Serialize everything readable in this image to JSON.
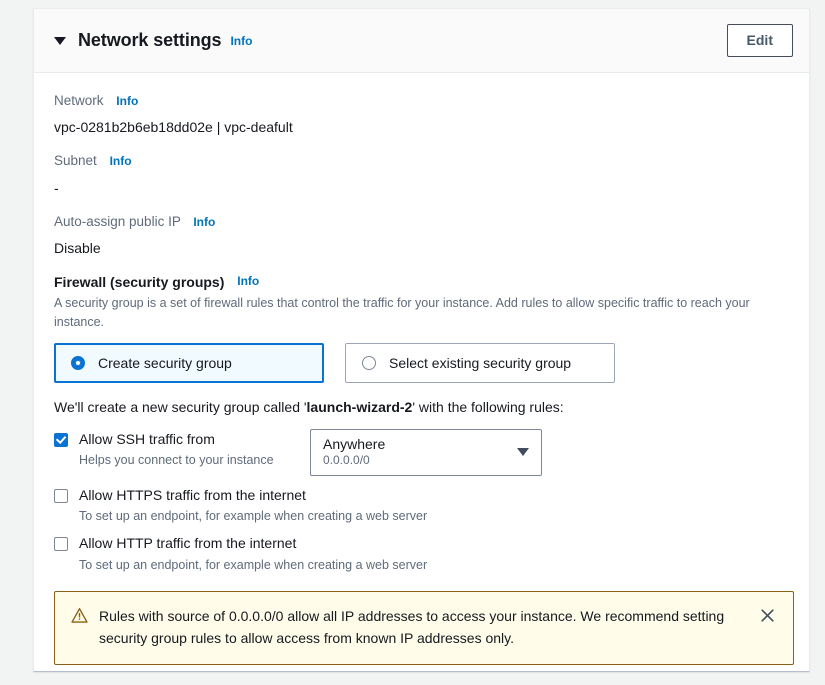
{
  "header": {
    "title": "Network settings",
    "info_label": "Info",
    "caret_icon": "caret-down-icon",
    "edit_label": "Edit"
  },
  "fields": [
    {
      "label": "Network",
      "info_label": "Info",
      "value": "vpc-0281b2b6eb18dd02e | vpc-deafult"
    },
    {
      "label": "Subnet",
      "info_label": "Info",
      "value": "-"
    },
    {
      "label": "Auto-assign public IP",
      "info_label": "Info",
      "value": "Disable"
    }
  ],
  "firewall": {
    "heading": "Firewall (security groups)",
    "info_label": "Info",
    "description": "A security group is a set of firewall rules that control the traffic for your instance. Add rules to allow specific traffic to reach your instance.",
    "options": [
      {
        "label": "Create security group",
        "selected": true
      },
      {
        "label": "Select existing security group",
        "selected": false
      }
    ],
    "rules_intro_prefix": "We'll create a new security group called '",
    "rules_intro_group": "launch-wizard-2",
    "rules_intro_suffix": "' with the following rules:",
    "rules": [
      {
        "title": "Allow SSH traffic from",
        "subtitle": "Helps you connect to your instance",
        "checked": true,
        "has_select": true,
        "select_value": "Anywhere",
        "select_sub": "0.0.0.0/0",
        "select_caret_icon": "caret-down-icon"
      },
      {
        "title": "Allow HTTPS traffic from the internet",
        "subtitle": "To set up an endpoint, for example when creating a web server",
        "checked": false,
        "has_select": false
      },
      {
        "title": "Allow HTTP traffic from the internet",
        "subtitle": "To set up an endpoint, for example when creating a web server",
        "checked": false,
        "has_select": false
      }
    ]
  },
  "alert": {
    "icon": "warning-triangle-icon",
    "message": "Rules with source of 0.0.0.0/0 allow all IP addresses to access your instance. We recommend setting security group rules to allow access from known IP addresses only.",
    "close_icon": "close-icon"
  },
  "colors": {
    "accent_blue": "#0972d3",
    "info_link": "#0073bb",
    "warning_border": "#8a6116",
    "warning_bg": "#fffce9",
    "page_bg": "#f2f3f3",
    "selected_tile_bg": "#f1faff"
  }
}
